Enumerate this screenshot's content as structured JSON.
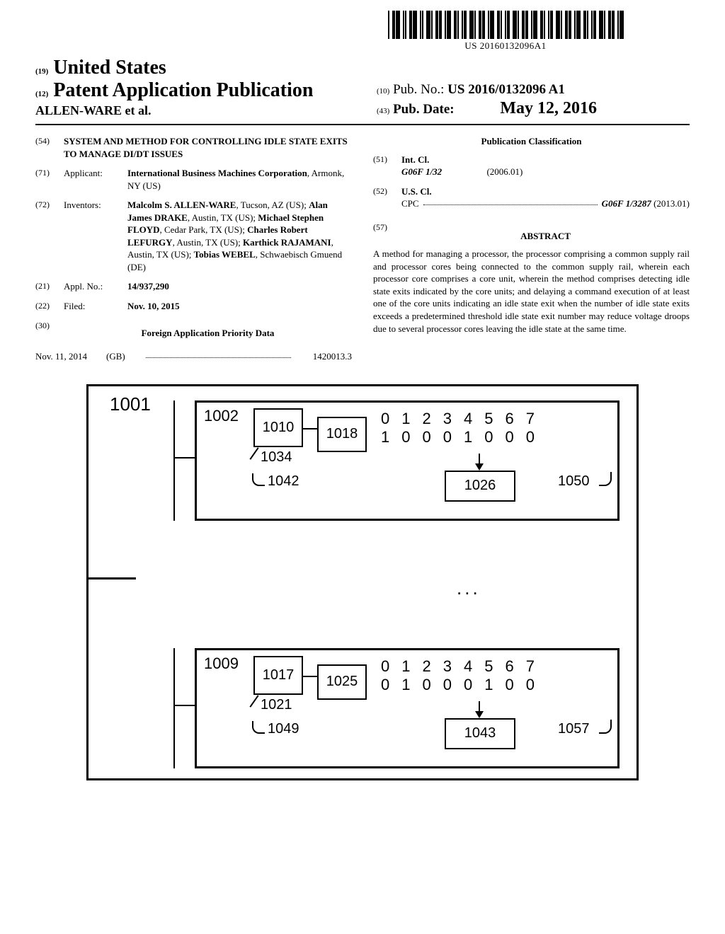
{
  "barcode_number": "US 20160132096A1",
  "header": {
    "line19_prefix": "(19)",
    "country": "United States",
    "line12_prefix": "(12)",
    "pub_type": "Patent Application Publication",
    "authors_line": "ALLEN-WARE et al.",
    "line10_prefix": "(10)",
    "pubno_label": "Pub. No.:",
    "pubno_value": "US 2016/0132096 A1",
    "line43_prefix": "(43)",
    "pubdate_label": "Pub. Date:",
    "pubdate_value": "May 12, 2016"
  },
  "left": {
    "f54_num": "(54)",
    "f54_title": "SYSTEM AND METHOD FOR CONTROLLING IDLE STATE EXITS TO MANAGE DI/DT ISSUES",
    "f71_num": "(71)",
    "f71_label": "Applicant:",
    "f71_body": "International Business Machines Corporation",
    "f71_loc": ", Armonk, NY (US)",
    "f72_num": "(72)",
    "f72_label": "Inventors:",
    "f72_body": "Malcolm S. ALLEN-WARE, Tucson, AZ (US); Alan James DRAKE, Austin, TX (US); Michael Stephen FLOYD, Cedar Park, TX (US); Charles Robert LEFURGY, Austin, TX (US); Karthick RAJAMANI, Austin, TX (US); Tobias WEBEL, Schwaebisch Gmuend (DE)",
    "f21_num": "(21)",
    "f21_label": "Appl. No.:",
    "f21_val": "14/937,290",
    "f22_num": "(22)",
    "f22_label": "Filed:",
    "f22_val": "Nov. 10, 2015",
    "f30_num": "(30)",
    "f30_head": "Foreign Application Priority Data",
    "foreign_date": "Nov. 11, 2014",
    "foreign_cc": "(GB)",
    "foreign_num": "1420013.3"
  },
  "right": {
    "class_head": "Publication Classification",
    "f51_num": "(51)",
    "f51_label": "Int. Cl.",
    "intcl_code": "G06F 1/32",
    "intcl_date": "(2006.01)",
    "f52_num": "(52)",
    "f52_label": "U.S. Cl.",
    "cpc_label": "CPC",
    "cpc_code": "G06F 1/3287",
    "cpc_date": "(2013.01)",
    "f57_num": "(57)",
    "abstract_head": "ABSTRACT",
    "abstract_text": "A method for managing a processor, the processor comprising a common supply rail and processor cores being connected to the common supply rail, wherein each processor core comprises a core unit, wherein the method comprises detecting idle state exits indicated by the core units; and delaying a command execution of at least one of the core units indicating an idle state exit when the number of idle state exits exceeds a predetermined threshold idle state exit number may reduce voltage droops due to several processor cores leaving the idle state at the same time."
  },
  "figure": {
    "outer_label": "1001",
    "dots": "...",
    "top": {
      "unit_label": "1002",
      "box1": "1010",
      "box2": "1018",
      "ptr_1034": "1034",
      "lbl_1042": "1042",
      "box_center": "1026",
      "lbl_right": "1050",
      "indices": [
        "0",
        "1",
        "2",
        "3",
        "4",
        "5",
        "6",
        "7"
      ],
      "bits": [
        "1",
        "0",
        "0",
        "0",
        "1",
        "0",
        "0",
        "0"
      ]
    },
    "bot": {
      "unit_label": "1009",
      "box1": "1017",
      "box2": "1025",
      "ptr_1034": "1021",
      "lbl_1042": "1049",
      "box_center": "1043",
      "lbl_right": "1057",
      "indices": [
        "0",
        "1",
        "2",
        "3",
        "4",
        "5",
        "6",
        "7"
      ],
      "bits": [
        "0",
        "1",
        "0",
        "0",
        "0",
        "1",
        "0",
        "0"
      ]
    }
  }
}
